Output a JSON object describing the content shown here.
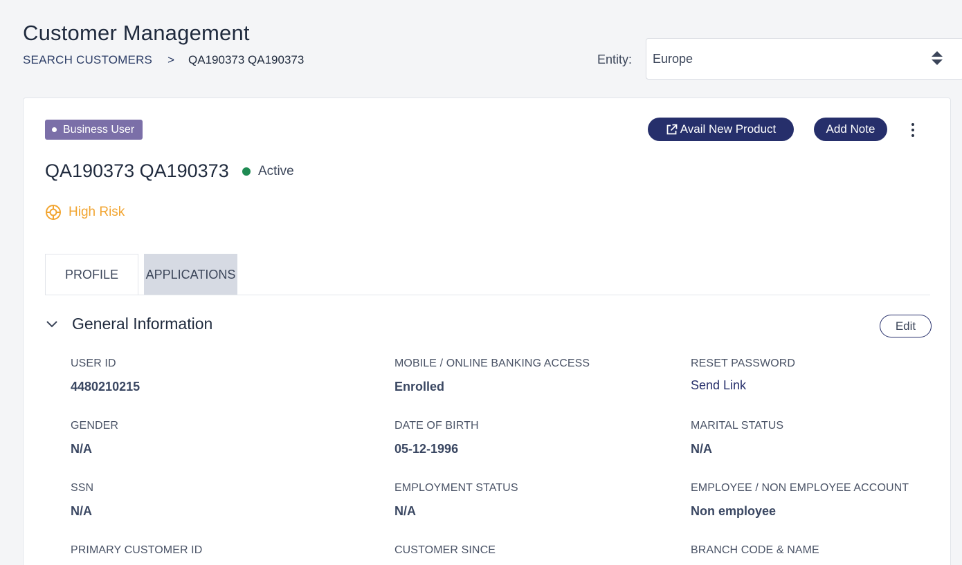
{
  "header": {
    "title": "Customer Management",
    "breadcrumb": {
      "link": "SEARCH CUSTOMERS",
      "separator": ">",
      "current": "QA190373 QA190373"
    },
    "entity": {
      "label": "Entity:",
      "value": "Europe"
    }
  },
  "customer": {
    "badge": "Business User",
    "name": "QA190373 QA190373",
    "status": "Active",
    "risk": "High Risk",
    "actions": {
      "avail_new_product": "Avail New Product",
      "add_note": "Add Note"
    }
  },
  "tabs": [
    {
      "label": "PROFILE",
      "active": true
    },
    {
      "label": "APPLICATIONS",
      "active": false
    }
  ],
  "general_information": {
    "title": "General Information",
    "edit_label": "Edit",
    "fields": {
      "user_id": {
        "label": "USER ID",
        "value": "4480210215"
      },
      "mobile_access": {
        "label": "MOBILE / ONLINE BANKING ACCESS",
        "value": "Enrolled"
      },
      "reset_password": {
        "label": "RESET PASSWORD",
        "value": "Send Link"
      },
      "gender": {
        "label": "GENDER",
        "value": "N/A"
      },
      "date_of_birth": {
        "label": "DATE OF BIRTH",
        "value": "05-12-1996"
      },
      "marital_status": {
        "label": "MARITAL STATUS",
        "value": "N/A"
      },
      "ssn": {
        "label": "SSN",
        "value": "N/A"
      },
      "employment_status": {
        "label": "EMPLOYMENT STATUS",
        "value": "N/A"
      },
      "employee_account": {
        "label": "EMPLOYEE / NON EMPLOYEE ACCOUNT",
        "value": "Non employee"
      },
      "primary_customer_id": {
        "label": "PRIMARY CUSTOMER ID"
      },
      "customer_since": {
        "label": "CUSTOMER SINCE"
      },
      "branch_code_name": {
        "label": "BRANCH CODE & NAME"
      }
    }
  },
  "colors": {
    "primary": "#262f6b",
    "badge": "#7b6fa8",
    "active_status": "#1e8a52",
    "risk": "#f2a531"
  }
}
